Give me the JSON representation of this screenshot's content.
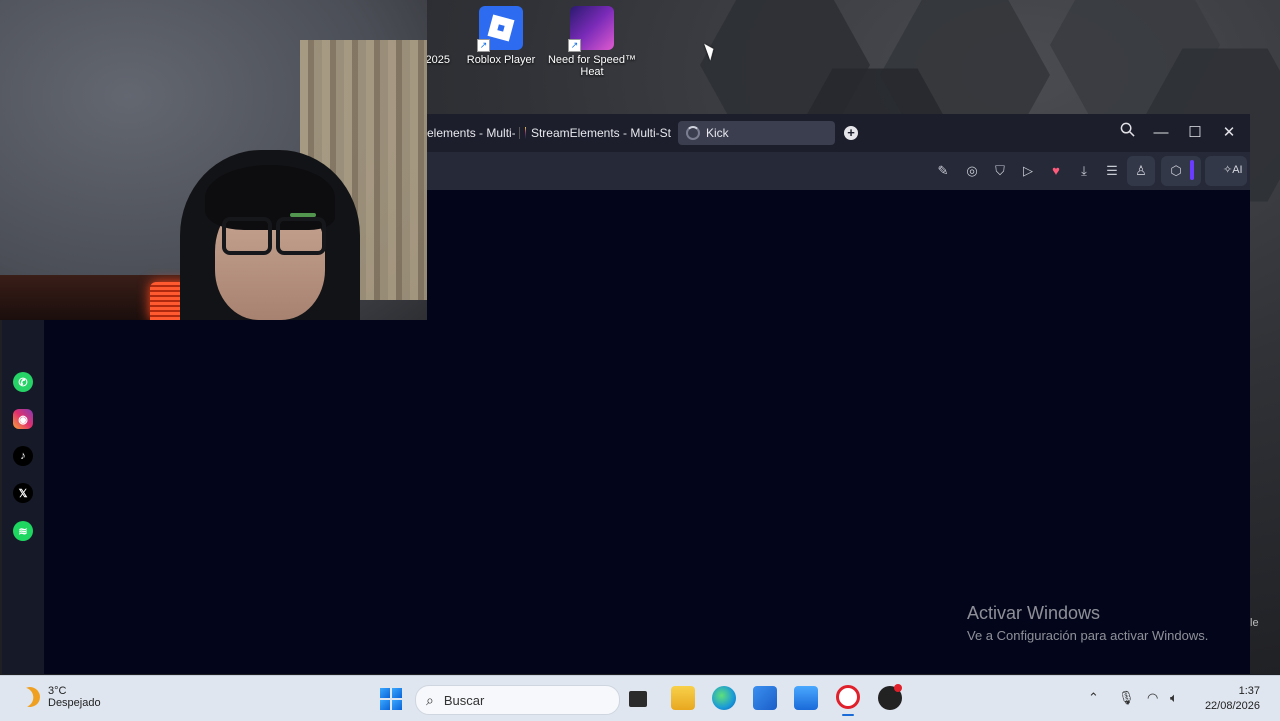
{
  "desktop": {
    "icons": [
      {
        "label": "2025"
      },
      {
        "label": "Roblox Player"
      },
      {
        "label": "Need for Speed™ Heat"
      }
    ]
  },
  "browser": {
    "tabs": [
      {
        "label": "elements - Multi-St"
      },
      {
        "label": "StreamElements - Multi-St"
      },
      {
        "label": "Kick"
      }
    ],
    "toolbar": {
      "ai_label": "AI"
    }
  },
  "sidebar": {
    "apps": [
      "whatsapp",
      "instagram",
      "tiktok",
      "x",
      "spotify"
    ]
  },
  "watermark": {
    "title": "Activar Windows",
    "subtitle": "Ve a Configuración para activar Windows.",
    "edge_fragment": "le"
  },
  "taskbar": {
    "weather_temp": "3°C",
    "weather_desc": "Despejado",
    "search_placeholder": "Buscar",
    "time": "1:37",
    "date": "22/08/2026"
  },
  "colors": {
    "browser_bg": "#03061a",
    "tab_active": "#3a3e4f",
    "extension_accent": "#6a3cff",
    "taskbar": "#dfe6f0"
  }
}
